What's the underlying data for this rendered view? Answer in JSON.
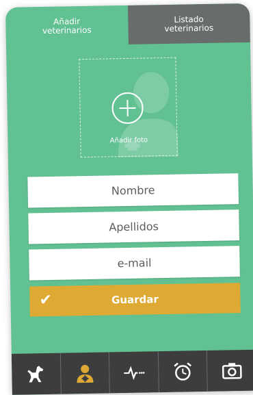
{
  "tabs": [
    {
      "label": "Añadir\nveterinarios",
      "active": true
    },
    {
      "label": "Listado\nveterinarios",
      "active": false
    }
  ],
  "photo": {
    "label": "Añadir foto",
    "icon": "add-photo-plus-icon"
  },
  "form": {
    "name_placeholder": "Nombre",
    "surname_placeholder": "Apellidos",
    "email_placeholder": "e-mail",
    "save_label": "Guardar",
    "save_check": "✔"
  },
  "nav": [
    {
      "icon": "dog-icon",
      "active": false
    },
    {
      "icon": "veterinarian-icon",
      "active": true
    },
    {
      "icon": "heartbeat-icon",
      "active": false
    },
    {
      "icon": "alarm-clock-icon",
      "active": false
    },
    {
      "icon": "camera-icon",
      "active": false
    }
  ],
  "colors": {
    "background_green": "#62c192",
    "inactive_tab": "#686d6c",
    "save_button": "#deaa34",
    "nav_bar": "#3d3d3d",
    "active_nav_icon": "#deaa34"
  }
}
